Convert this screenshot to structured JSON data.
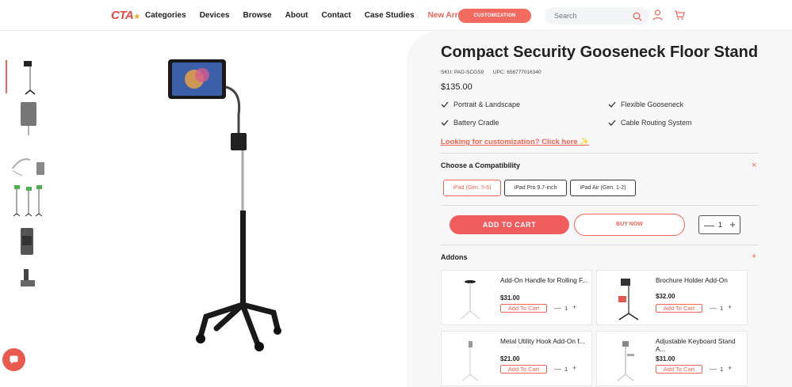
{
  "header": {
    "logo_text": "CTA",
    "nav": [
      "Categories",
      "Devices",
      "Browse",
      "About",
      "Contact",
      "Case Studies",
      "New Arrivals"
    ],
    "customization_label": "CUSTOMIZATION",
    "search_placeholder": "Search"
  },
  "product": {
    "title": "Compact Security Gooseneck Floor Stand",
    "sku": "SKU: PAD-SCGS9",
    "upc": "UPC: 656777016340",
    "price": "$135.00",
    "features": [
      "Portrait & Landscape",
      "Flexible Gooseneck",
      "Battery Cradle",
      "Cable Routing System"
    ],
    "customization_link": "Looking for customization? Click here"
  },
  "compatibility": {
    "title": "Choose a Compatibility",
    "toggle_icon": "close-icon",
    "options": [
      "iPad (Gen. 5-6)",
      "iPad Pro 9.7-inch",
      "iPad Air (Gen. 1-2)"
    ],
    "selected_index": 0
  },
  "actions": {
    "add_to_cart": "ADD TO CART",
    "buy_now": "BUY NOW",
    "quantity": "1",
    "minus": "—",
    "plus": "+"
  },
  "addons": {
    "title": "Addons",
    "toggle_icon": "plus-icon",
    "items": [
      {
        "name": "Add-On Handle for Rolling F...",
        "price": "$31.00",
        "button": "Add To Cart",
        "qty": "1"
      },
      {
        "name": "Brochure Holder Add-On",
        "price": "$32.00",
        "button": "Add To Cart",
        "qty": "1"
      },
      {
        "name": "Metal Utility Hook Add-On f...",
        "price": "$21.00",
        "button": "Add To Cart",
        "qty": "1"
      },
      {
        "name": "Adjustable Keyboard Stand A...",
        "price": "$31.00",
        "button": "Add To Cart",
        "qty": "1"
      }
    ]
  },
  "colors": {
    "accent": "#f26457",
    "panel_bg": "#f7f7f7"
  }
}
